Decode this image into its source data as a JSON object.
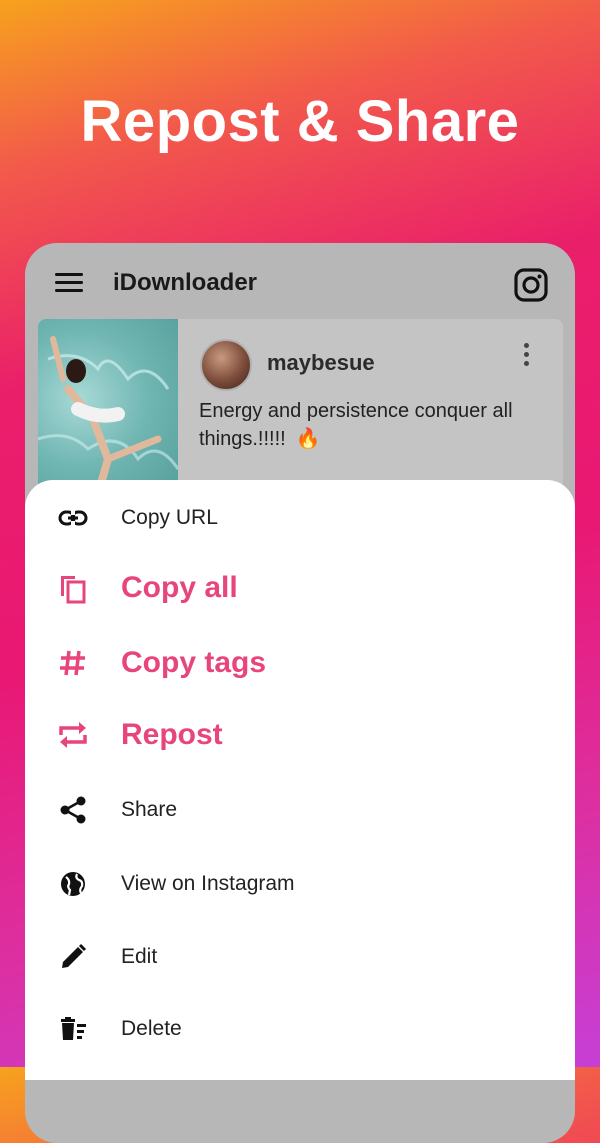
{
  "headline": "Repost & Share",
  "app": {
    "title": "iDownloader",
    "menu_icon": "hamburger-menu-icon",
    "instagram_icon": "instagram-icon"
  },
  "post": {
    "username": "maybesue",
    "caption": "Energy and persistence conquer all things.!!!!!",
    "caption_emoji": "🔥"
  },
  "menu": {
    "items": [
      {
        "label": "Copy URL",
        "icon": "link-icon",
        "style": "normal"
      },
      {
        "label": "Copy all",
        "icon": "copy-icon",
        "style": "accent"
      },
      {
        "label": "Copy tags",
        "icon": "hashtag-icon",
        "style": "accent"
      },
      {
        "label": "Repost",
        "icon": "repost-icon",
        "style": "accent"
      },
      {
        "label": "Share",
        "icon": "share-icon",
        "style": "normal"
      },
      {
        "label": "View on Instagram",
        "icon": "globe-icon",
        "style": "normal"
      },
      {
        "label": "Edit",
        "icon": "pencil-icon",
        "style": "normal"
      },
      {
        "label": "Delete",
        "icon": "trash-icon",
        "style": "normal"
      }
    ]
  },
  "colors": {
    "accent": "#e7457c",
    "icon_dark": "#111111"
  }
}
